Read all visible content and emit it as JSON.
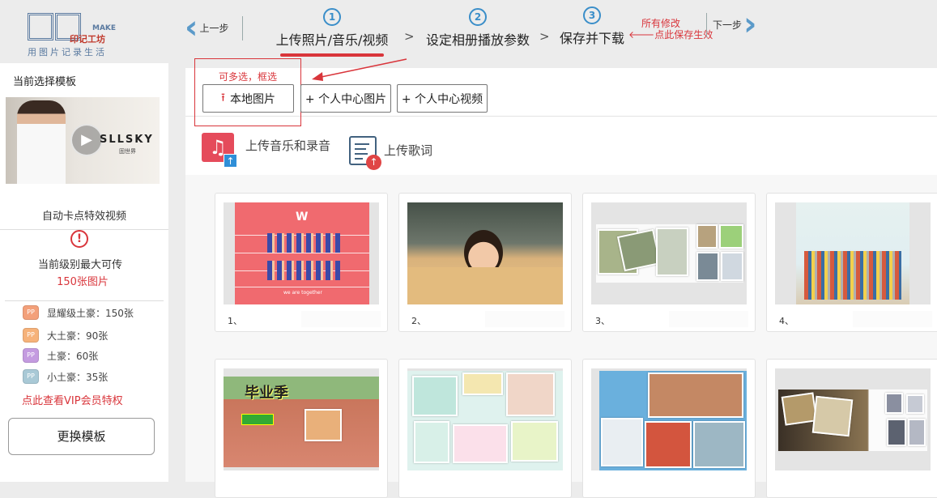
{
  "logo": {
    "make": "MAKE",
    "brand": "印记工坊",
    "slogan": "用图片记录生活"
  },
  "nav": {
    "prev_label": "上一步",
    "next_label": "下一步",
    "steps": [
      {
        "num": "1",
        "label": "上传照片/音乐/视频",
        "active": true
      },
      {
        "num": "2",
        "label": "设定相册播放参数",
        "active": false
      },
      {
        "num": "3",
        "label": "保存并下载",
        "active": false
      }
    ],
    "separator": ">",
    "notice_line1": "所有修改",
    "notice_line2": "点此保存生效"
  },
  "sidebar": {
    "title": "当前选择模板",
    "thumb_brand": "SLLSKY",
    "thumb_brand_sub": "固世界",
    "template_name": "自动卡点特效视频",
    "level_text": "当前级别最大可传",
    "max_text": "150张图片",
    "tiers": [
      {
        "label": "显耀级土豪：150张",
        "color": "#f3a07a"
      },
      {
        "label": "大土豪：90张",
        "color": "#f6b27a"
      },
      {
        "label": "土豪：60张",
        "color": "#c49be0"
      },
      {
        "label": "小土豪：35张",
        "color": "#a9c9d6"
      }
    ],
    "vip_link": "点此查看VIP会员特权",
    "change_button": "更换模板"
  },
  "upload": {
    "hint": "可多选，框选",
    "local_button": "本地图片",
    "personal_photo_button": "+ 个人中心图片",
    "personal_video_button": "+ 个人中心视频",
    "music_label": "上传音乐和录音",
    "lyrics_label": "上传歌词"
  },
  "thumbnails": {
    "t1_word": "W",
    "t1_footer": "we are together",
    "t5_title": "毕业季"
  },
  "cards": [
    {
      "caption": "1、"
    },
    {
      "caption": "2、"
    },
    {
      "caption": "3、"
    },
    {
      "caption": "4、"
    },
    {
      "caption": ""
    },
    {
      "caption": ""
    },
    {
      "caption": ""
    },
    {
      "caption": ""
    }
  ],
  "colors": {
    "accent_red": "#d9353b",
    "step_blue": "#3a8ec9",
    "nav_arrow": "#5b9ac9"
  }
}
